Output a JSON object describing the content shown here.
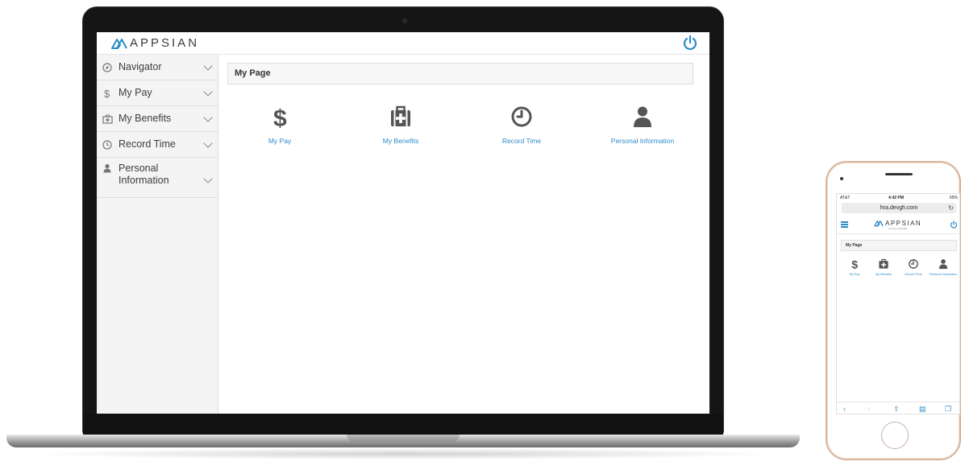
{
  "app": {
    "brand": "APPSIAN",
    "brand_color": "#2d8bc9"
  },
  "sidebar": {
    "items": [
      {
        "label": "Navigator",
        "icon": "compass-icon"
      },
      {
        "label": "My Pay",
        "icon": "dollar-icon"
      },
      {
        "label": "My Benefits",
        "icon": "medical-kit-icon"
      },
      {
        "label": "Record Time",
        "icon": "clock-icon"
      },
      {
        "label": "Personal Information",
        "icon": "user-icon"
      }
    ]
  },
  "main": {
    "page_title": "My Page",
    "tiles": [
      {
        "label": "My Pay",
        "icon": "dollar-icon"
      },
      {
        "label": "My Benefits",
        "icon": "medical-kit-icon"
      },
      {
        "label": "Record Time",
        "icon": "clock-icon"
      },
      {
        "label": "Personal Information",
        "icon": "user-icon"
      }
    ]
  },
  "phone": {
    "status": {
      "carrier": "AT&T",
      "time": "4:42 PM",
      "battery": "65%"
    },
    "url": "hra.devgh.com",
    "brand": "APPSIAN",
    "brand_sub": "Formerly GreyHeller",
    "page_title": "My Page",
    "tiles": [
      {
        "label": "My Pay"
      },
      {
        "label": "My Benefits"
      },
      {
        "label": "Record Time"
      },
      {
        "label": "Personal Information"
      }
    ]
  }
}
